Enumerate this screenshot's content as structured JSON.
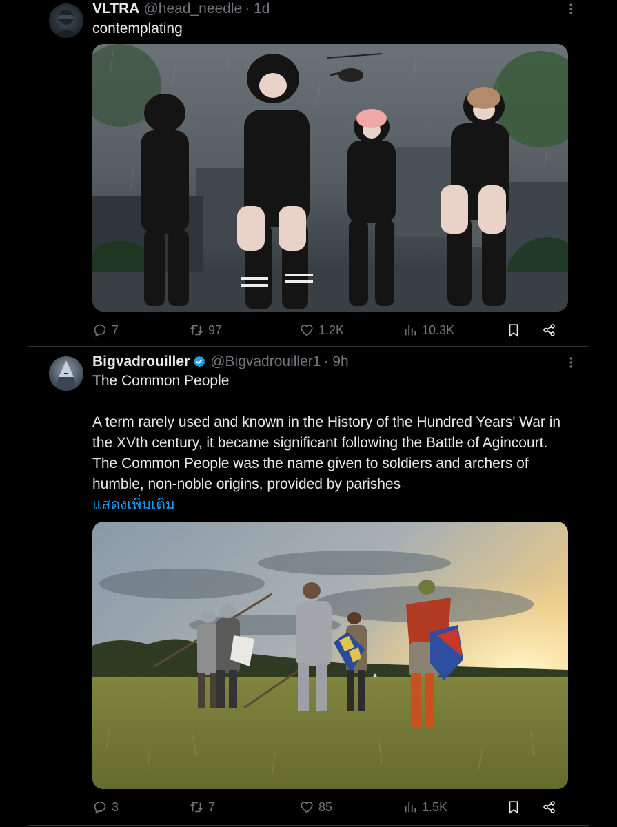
{
  "tweets": [
    {
      "name": "VLTRA",
      "handle": "@head_needle",
      "time": "· 1d",
      "verified": false,
      "text": "contemplating",
      "replies": "7",
      "retweets": "97",
      "likes": "1.2K",
      "views": "10.3K"
    },
    {
      "name": "Bigvadrouiller",
      "handle": "@Bigvadrouiller1",
      "time": "· 9h",
      "verified": true,
      "text_title": "The Common People",
      "text_body": "A term rarely used and known in the History of the Hundred Years' War in the XVth century, it became significant following the Battle of Agincourt. The Common People was the name given to soldiers and archers of humble, non-noble origins, provided by parishes",
      "show_more": "แสดงเพิ่มเติม",
      "replies": "3",
      "retweets": "7",
      "likes": "85",
      "views": "1.5K"
    }
  ],
  "icons": {
    "reply": "reply-icon",
    "retweet": "retweet-icon",
    "like": "like-icon",
    "views": "views-icon",
    "bookmark": "bookmark-icon",
    "share": "share-icon",
    "more": "more-icon",
    "verified": "verified-badge-icon"
  },
  "colors": {
    "background": "#000000",
    "text": "#e7e9ea",
    "muted": "#71767b",
    "link": "#1d9bf0",
    "divider": "#2f3336"
  }
}
